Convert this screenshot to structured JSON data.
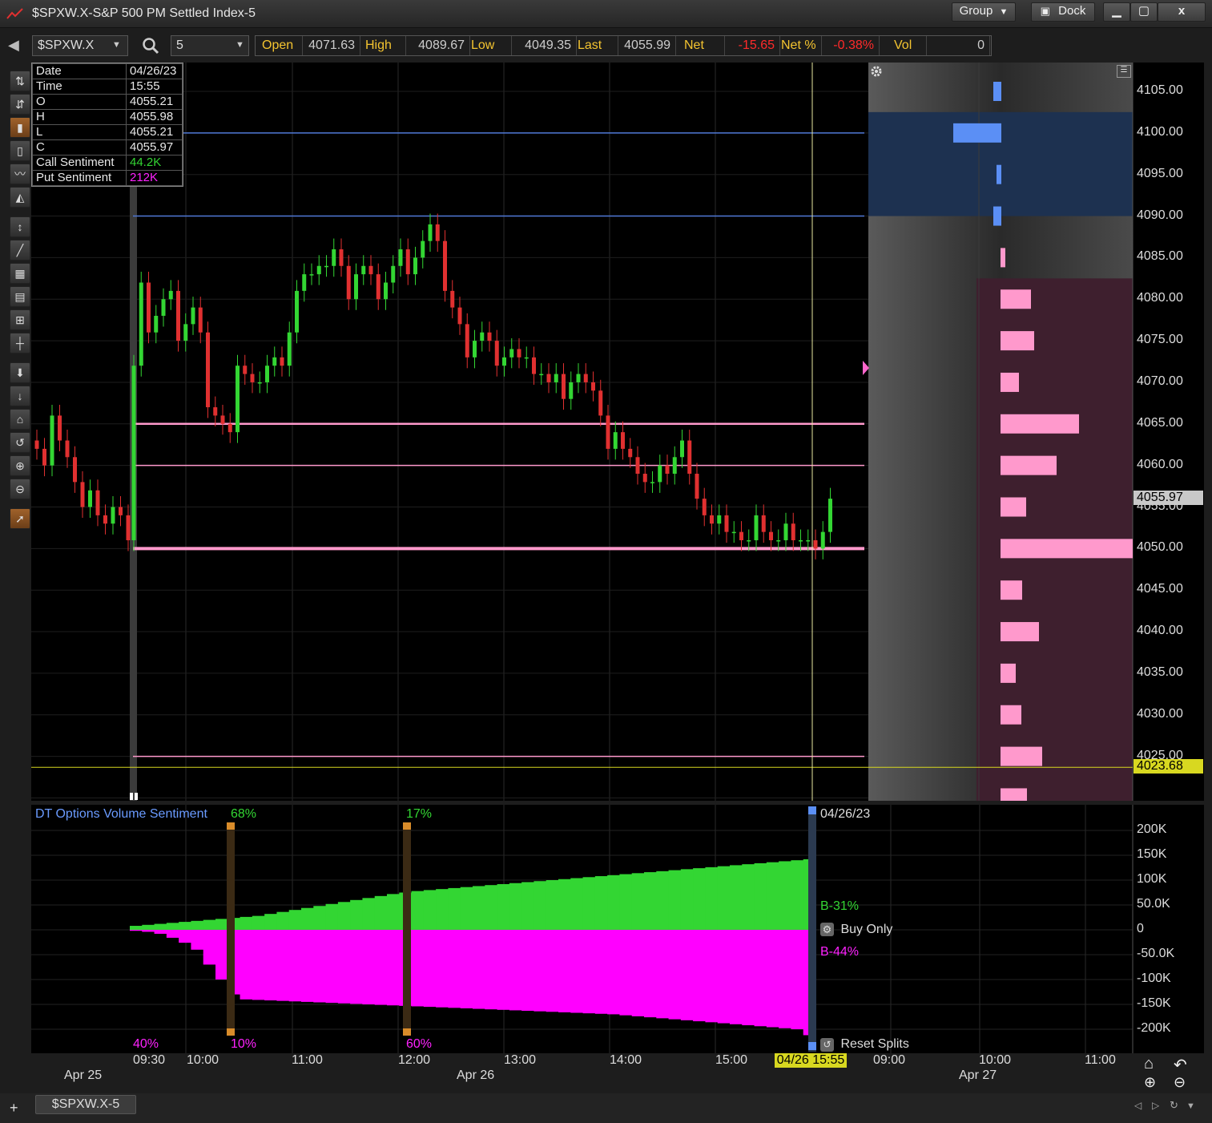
{
  "window": {
    "title": "$SPXW.X-S&P 500 PM Settled Index-5",
    "group_label": "Group",
    "dock_label": "Dock",
    "min_icon": "minimize-icon",
    "max_icon": "maximize-icon",
    "close_label": "x"
  },
  "toolbar": {
    "symbol": "$SPXW.X",
    "interval": "5",
    "quote": [
      {
        "label": "Open",
        "value": "4071.63",
        "neg": false
      },
      {
        "label": "High",
        "value": "4089.67",
        "neg": false
      },
      {
        "label": "Low",
        "value": "4049.35",
        "neg": false
      },
      {
        "label": "Last",
        "value": "4055.99",
        "neg": false
      },
      {
        "label": "Net",
        "value": "-15.65",
        "neg": true
      },
      {
        "label": "Net %",
        "value": "-0.38%",
        "neg": true
      },
      {
        "label": "Vol",
        "value": "0",
        "neg": false
      }
    ]
  },
  "data_window": {
    "rows": [
      {
        "k": "Date",
        "v": "04/26/23",
        "color": "#e8e8e8"
      },
      {
        "k": "Time",
        "v": "15:55",
        "color": "#e8e8e8"
      },
      {
        "k": "O",
        "v": "4055.21",
        "color": "#e8e8e8"
      },
      {
        "k": "H",
        "v": "4055.98",
        "color": "#e8e8e8"
      },
      {
        "k": "L",
        "v": "4055.21",
        "color": "#e8e8e8"
      },
      {
        "k": "C",
        "v": "4055.97",
        "color": "#e8e8e8"
      },
      {
        "k": "Call Sentiment",
        "v": "44.2K",
        "color": "#33d633"
      },
      {
        "k": "Put Sentiment",
        "v": "212K",
        "color": "#ff22ff"
      }
    ]
  },
  "chart_data": [
    {
      "type": "candlestick",
      "title": "",
      "ylim": [
        4020,
        4109
      ],
      "y_ticks": [
        "4105.00",
        "4100.00",
        "4095.00",
        "4090.00",
        "4085.00",
        "4080.00",
        "4075.00",
        "4070.00",
        "4065.00",
        "4060.00",
        "4055.00",
        "4050.00",
        "4045.00",
        "4040.00",
        "4035.00",
        "4030.00",
        "4025.00"
      ],
      "last_price_label": "4055.97",
      "yellow_line_label": "4023.68",
      "levels": [
        {
          "price": 4100,
          "color": "#4f78d6"
        },
        {
          "price": 4090,
          "color": "#4f78d6"
        },
        {
          "price": 4065,
          "color": "#ff99cc"
        },
        {
          "price": 4060,
          "color": "#ff99cc"
        },
        {
          "price": 4050,
          "color": "#ff99cc"
        },
        {
          "price": 4025,
          "color": "#ff99cc"
        }
      ],
      "apr25_closes": [
        4062,
        4060,
        4066,
        4063,
        4061,
        4058,
        4055,
        4057,
        4054,
        4053,
        4055,
        4054,
        4051
      ],
      "apr26_closes": [
        4072,
        4082,
        4076,
        4078,
        4080,
        4081,
        4075,
        4077,
        4079,
        4076,
        4067,
        4066,
        4065,
        4064,
        4072,
        4071,
        4070,
        4070,
        4072,
        4073,
        4072,
        4076,
        4081,
        4083,
        4083,
        4084,
        4084,
        4086,
        4084,
        4080,
        4083,
        4084,
        4083,
        4080,
        4082,
        4084,
        4086,
        4083,
        4085,
        4087,
        4089,
        4087,
        4081,
        4079,
        4077,
        4073,
        4075,
        4076,
        4075,
        4072,
        4073,
        4074,
        4073,
        4073,
        4071,
        4071,
        4070,
        4071,
        4068,
        4070,
        4071,
        4070,
        4069,
        4066,
        4062,
        4064,
        4062,
        4061,
        4059,
        4058,
        4058,
        4060,
        4059,
        4061,
        4063,
        4059,
        4056,
        4054,
        4053,
        4054,
        4052,
        4052,
        4051,
        4051,
        4054,
        4052,
        4051,
        4051,
        4053,
        4051,
        4051,
        4051,
        4050,
        4052,
        4056
      ],
      "options_volume": [
        {
          "price": 4105,
          "calls": 1
        },
        {
          "price": 4100,
          "calls": 6
        },
        {
          "price": 4095,
          "calls": 0.6
        },
        {
          "price": 4090,
          "calls": 1
        },
        {
          "price": 4085,
          "puts": 0.6
        },
        {
          "price": 4080,
          "puts": 3.8
        },
        {
          "price": 4075,
          "puts": 4.2
        },
        {
          "price": 4070,
          "puts": 2.3
        },
        {
          "price": 4065,
          "puts": 9.8
        },
        {
          "price": 4060,
          "puts": 7
        },
        {
          "price": 4055,
          "puts": 3.2
        },
        {
          "price": 4050,
          "puts": 16.5
        },
        {
          "price": 4045,
          "puts": 2.7
        },
        {
          "price": 4040,
          "puts": 4.8
        },
        {
          "price": 4035,
          "puts": 1.9
        },
        {
          "price": 4030,
          "puts": 2.6
        },
        {
          "price": 4025,
          "puts": 5.2
        },
        {
          "price": 4020,
          "puts": 3.3
        }
      ]
    },
    {
      "type": "area",
      "title": "DT Options Volume Sentiment",
      "ylim": [
        -250000,
        250000
      ],
      "y_ticks": [
        "200K",
        "150K",
        "100K",
        "50.0K",
        "0",
        "-50.0K",
        "-100K",
        "-150K",
        "-200K"
      ],
      "split_markers": [
        {
          "top": "68%",
          "bottom": "10%"
        },
        {
          "top": "17%",
          "bottom": "60%"
        }
      ],
      "left_bottom_label": "40%",
      "date_label": "04/26/23",
      "buy_label": "B-31%",
      "sell_label": "B-44%",
      "buy_only_label": "Buy Only",
      "reset_splits_label": "Reset Splits",
      "calls": [
        8,
        10,
        12,
        14,
        16,
        18,
        20,
        22,
        24,
        26,
        28,
        32,
        36,
        40,
        44,
        48,
        52,
        56,
        60,
        64,
        68,
        72,
        75,
        78,
        80,
        82,
        84,
        86,
        88,
        90,
        92,
        94,
        96,
        98,
        100,
        102,
        104,
        106,
        108,
        110,
        112,
        114,
        116,
        118,
        120,
        122,
        124,
        126,
        128,
        130,
        132,
        134,
        136,
        138,
        140,
        142
      ],
      "puts": [
        2,
        4,
        8,
        16,
        26,
        40,
        70,
        100,
        130,
        140,
        141,
        142,
        143,
        144,
        145,
        146,
        147,
        148,
        149,
        150,
        151,
        152,
        153,
        154,
        155,
        156,
        157,
        158,
        159,
        160,
        161,
        162,
        163,
        164,
        165,
        166,
        167,
        168,
        169,
        170,
        172,
        174,
        176,
        178,
        180,
        182,
        184,
        186,
        188,
        190,
        192,
        194,
        196,
        198,
        200,
        212
      ]
    }
  ],
  "time_axis": {
    "labels": [
      "09:30",
      "10:00",
      "11:00",
      "12:00",
      "13:00",
      "14:00",
      "15:00",
      "09:00",
      "10:00",
      "11:00"
    ],
    "dates": [
      "Apr 25",
      "Apr 26",
      "Apr 27"
    ],
    "cursor_label": "04/26 15:55"
  },
  "tabs": [
    {
      "label": "$SPXW.X-5"
    }
  ]
}
